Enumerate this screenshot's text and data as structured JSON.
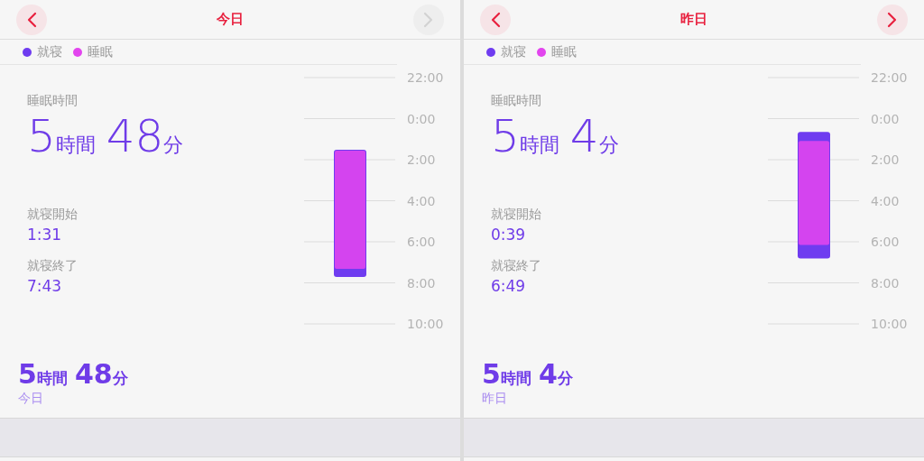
{
  "panels": [
    {
      "title": "今日",
      "prev_button": {
        "disabled": false
      },
      "next_button": {
        "disabled": true
      },
      "legend": [
        {
          "label": "就寝",
          "color": "#6f3cf0"
        },
        {
          "label": "睡眠",
          "color": "#e245ee"
        }
      ],
      "sleep_time_label": "睡眠時間",
      "duration": [
        {
          "value": "5",
          "unit": "時間"
        },
        {
          "value": "48",
          "unit": "分"
        }
      ],
      "times": [
        {
          "label": "就寝開始",
          "value": "1:31"
        },
        {
          "label": "就寝終了",
          "value": "7:43"
        }
      ],
      "axis_labels": [
        "22:00",
        "0:00",
        "2:00",
        "4:00",
        "6:00",
        "8:00",
        "10:00"
      ],
      "summary": {
        "duration": [
          {
            "value": "5",
            "unit": "時間"
          },
          {
            "value": "48",
            "unit": "分"
          }
        ],
        "day": "今日"
      }
    },
    {
      "title": "昨日",
      "prev_button": {
        "disabled": false
      },
      "next_button": {
        "disabled": false
      },
      "legend": [
        {
          "label": "就寝",
          "color": "#6f3cf0"
        },
        {
          "label": "睡眠",
          "color": "#e245ee"
        }
      ],
      "sleep_time_label": "睡眠時間",
      "duration": [
        {
          "value": "5",
          "unit": "時間"
        },
        {
          "value": "4",
          "unit": "分"
        }
      ],
      "times": [
        {
          "label": "就寝開始",
          "value": "0:39"
        },
        {
          "label": "就寝終了",
          "value": "6:49"
        }
      ],
      "axis_labels": [
        "22:00",
        "0:00",
        "2:00",
        "4:00",
        "6:00",
        "8:00",
        "10:00"
      ],
      "summary": {
        "duration": [
          {
            "value": "5",
            "unit": "時間"
          },
          {
            "value": "4",
            "unit": "分"
          }
        ],
        "day": "昨日"
      }
    }
  ]
}
